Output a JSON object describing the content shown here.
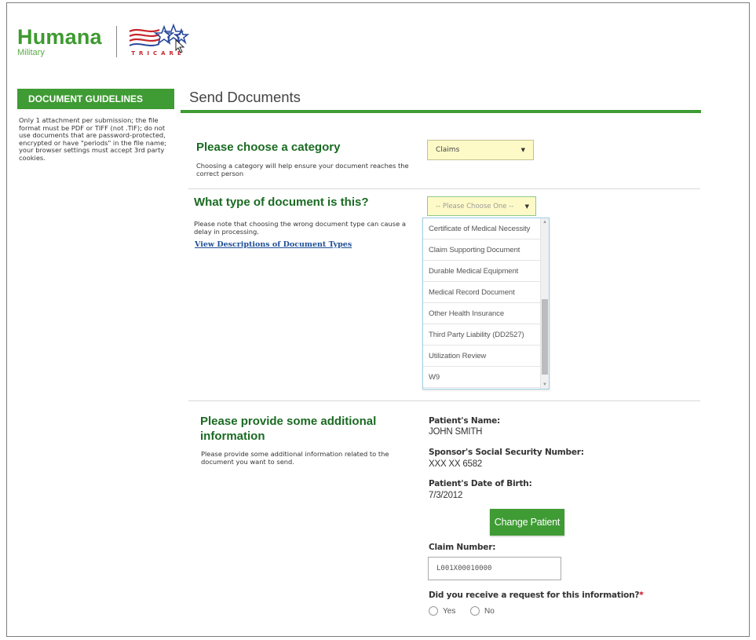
{
  "brand": {
    "name": "Humana",
    "sub": "Military",
    "partner_logo_text": "TRICARE"
  },
  "sidebar": {
    "header": "DOCUMENT GUIDELINES",
    "text": "Only 1 attachment per submission; the file format must be PDF or TIFF (not .TIF); do not use documents that are password-protected, encrypted or have \"periods\" in the file name; your browser settings must accept 3rd party cookies."
  },
  "page": {
    "title": "Send Documents"
  },
  "category": {
    "heading": "Please choose a category",
    "description": "Choosing a category will help ensure your document reaches the correct person",
    "selected": "Claims"
  },
  "doc_type": {
    "heading": "What type of document is this?",
    "description": "Please note that choosing the wrong document type can cause a delay in processing.",
    "link": "View Descriptions of Document Types",
    "placeholder": "-- Please Choose One --",
    "options": [
      "Certificate of Medical Necessity",
      "Claim Supporting Document",
      "Durable Medical Equipment",
      "Medical Record Document",
      "Other Health Insurance",
      "Third Party Liability (DD2527)",
      "Utilization Review",
      "W9"
    ]
  },
  "additional": {
    "heading": "Please provide some additional information",
    "description": "Please provide some additional information related to the document you want to send.",
    "patient_name_label": "Patient's Name:",
    "patient_name": "JOHN SMITH",
    "ssn_label": "Sponsor's Social Security Number:",
    "ssn": "XXX XX 6582",
    "dob_label": "Patient's Date of Birth:",
    "dob": "7/3/2012",
    "change_patient": "Change Patient",
    "claim_label": "Claim Number:",
    "claim_value": "L001X00010000",
    "request_question": "Did you receive a request for this information?",
    "required_mark": "*",
    "yes": "Yes",
    "no": "No"
  }
}
